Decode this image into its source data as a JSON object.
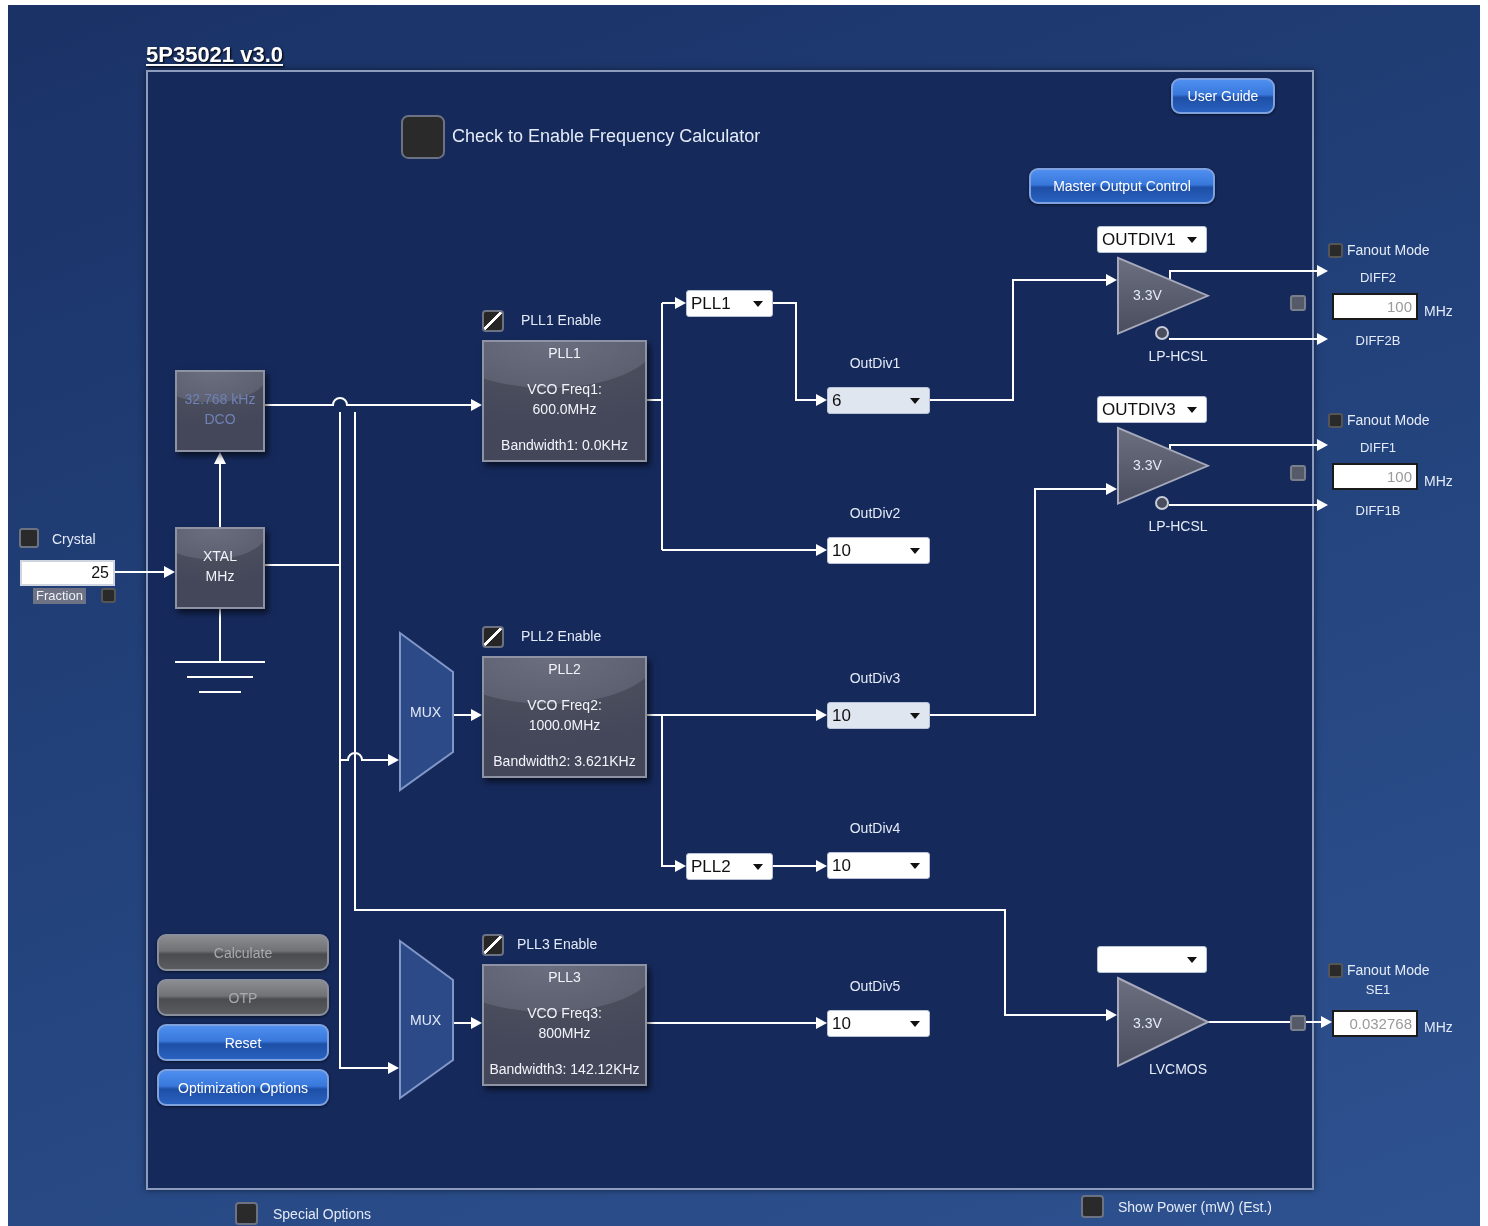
{
  "title": "5P35021 v3.0",
  "user_guide_button": "User Guide",
  "frequency_calculator": {
    "label": "Check to Enable Frequency Calculator",
    "checked": false
  },
  "master_output_button": "Master Output Control",
  "crystal": {
    "label": "Crystal",
    "checked": false,
    "value": "25",
    "fraction_label": "Fraction",
    "fraction_checked": false
  },
  "dco": {
    "frequency": "32.768 kHz",
    "name": "DCO",
    "disabled": true
  },
  "xtal": {
    "name": "XTAL",
    "unit": "MHz"
  },
  "muxes": [
    "MUX",
    "MUX"
  ],
  "plls": [
    {
      "enable_label": "PLL1 Enable",
      "enabled": true,
      "name": "PLL1",
      "vco_label": "VCO Freq1:",
      "vco_value": "600.0MHz",
      "bandwidth": "Bandwidth1: 0.0KHz"
    },
    {
      "enable_label": "PLL2 Enable",
      "enabled": true,
      "name": "PLL2",
      "vco_label": "VCO Freq2:",
      "vco_value": "1000.0MHz",
      "bandwidth": "Bandwidth2: 3.621KHz"
    },
    {
      "enable_label": "PLL3 Enable",
      "enabled": true,
      "name": "PLL3",
      "vco_label": "VCO Freq3:",
      "vco_value": "800MHz",
      "bandwidth": "Bandwidth3: 142.12KHz"
    }
  ],
  "pll_selects": [
    "PLL1",
    "PLL2"
  ],
  "output_dividers": [
    {
      "label": "OutDiv1",
      "value": "6",
      "highlighted": true
    },
    {
      "label": "OutDiv2",
      "value": "10",
      "highlighted": false
    },
    {
      "label": "OutDiv3",
      "value": "10",
      "highlighted": true
    },
    {
      "label": "OutDiv4",
      "value": "10",
      "highlighted": false
    },
    {
      "label": "OutDiv5",
      "value": "10",
      "highlighted": false
    }
  ],
  "outputs": [
    {
      "kind": "differential",
      "divider_select": "OUTDIV1",
      "voltage": "3.3V",
      "standard": "LP-HCSL",
      "enable_checked": false,
      "fanout_label": "Fanout Mode",
      "fanout_checked": false,
      "signal": "DIFF2",
      "complement_signal": "DIFF2B",
      "frequency": "100",
      "unit": "MHz"
    },
    {
      "kind": "differential",
      "divider_select": "OUTDIV3",
      "voltage": "3.3V",
      "standard": "LP-HCSL",
      "enable_checked": false,
      "fanout_label": "Fanout Mode",
      "fanout_checked": false,
      "signal": "DIFF1",
      "complement_signal": "DIFF1B",
      "frequency": "100",
      "unit": "MHz"
    },
    {
      "kind": "single",
      "voltage": "3.3V",
      "standard": "LVCMOS",
      "enable_checked": false,
      "fanout_label": "Fanout Mode",
      "fanout_checked": false,
      "signal": "SE1",
      "frequency": "0.032768",
      "unit": "MHz"
    }
  ],
  "buttons": [
    {
      "label": "Calculate",
      "disabled": true
    },
    {
      "label": "OTP",
      "disabled": true
    },
    {
      "label": "Reset",
      "disabled": false
    },
    {
      "label": "Optimization Options",
      "disabled": false
    }
  ],
  "special_options": {
    "label": "Special Options",
    "checked": false
  },
  "show_power": {
    "label": "Show Power (mW) (Est.)",
    "checked": false
  }
}
